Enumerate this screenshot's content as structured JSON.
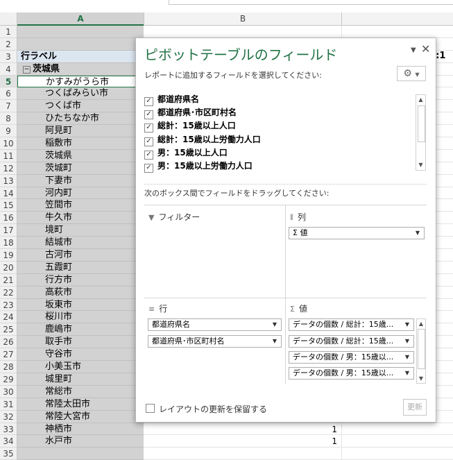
{
  "columns": {
    "a": "A",
    "b": "B"
  },
  "pivot_header": {
    "row_label": "行ラベル",
    "right_partial": "t:1"
  },
  "group": "茨城県",
  "row_numbers": [
    "1",
    "2",
    "3",
    "4",
    "5",
    "6",
    "7",
    "8",
    "9",
    "10",
    "11",
    "12",
    "13",
    "14",
    "15",
    "16",
    "17",
    "18",
    "19",
    "20",
    "21",
    "22",
    "23",
    "24",
    "25",
    "26",
    "27",
    "28",
    "29",
    "30",
    "31",
    "32",
    "33",
    "34",
    "35"
  ],
  "items": [
    "かすみがうら市",
    "つくばみらい市",
    "つくば市",
    "ひたちなか市",
    "阿見町",
    "稲敷市",
    "茨城県",
    "茨城町",
    "下妻市",
    "河内町",
    "笠間市",
    "牛久市",
    "境町",
    "結城市",
    "古河市",
    "五霞町",
    "行方市",
    "高萩市",
    "坂東市",
    "桜川市",
    "鹿嶋市",
    "取手市",
    "守谷市",
    "小美玉市",
    "城里町",
    "常総市",
    "常陸太田市",
    "常陸大宮市",
    "神栖市",
    "水戸市"
  ],
  "b_values": {
    "r33": "1",
    "r34": "1"
  },
  "pane": {
    "title": "ピボットテーブルのフィールド",
    "subtitle": "レポートに追加するフィールドを選択してください:",
    "fields": [
      "都道府県名",
      "都道府県･市区町村名",
      "総計：15歳以上人口",
      "総計：15歳以上労働力人口",
      "男：15歳以上人口",
      "男：15歳以上労働力人口"
    ],
    "drag_hint": "次のボックス間でフィールドをドラッグしてください:",
    "filter_label": "フィルター",
    "columns_label": "列",
    "rows_label": "行",
    "values_label": "値",
    "column_pills": [
      "Σ 値"
    ],
    "row_pills": [
      "都道府県名",
      "都道府県･市区町村名"
    ],
    "value_pills": [
      "データの個数 / 総計：15歳...",
      "データの個数 / 総計：15歳...",
      "データの個数 / 男：15歳以...",
      "データの個数 / 男：15歳以..."
    ],
    "defer_label": "レイアウトの更新を保留する",
    "update_label": "更新"
  }
}
